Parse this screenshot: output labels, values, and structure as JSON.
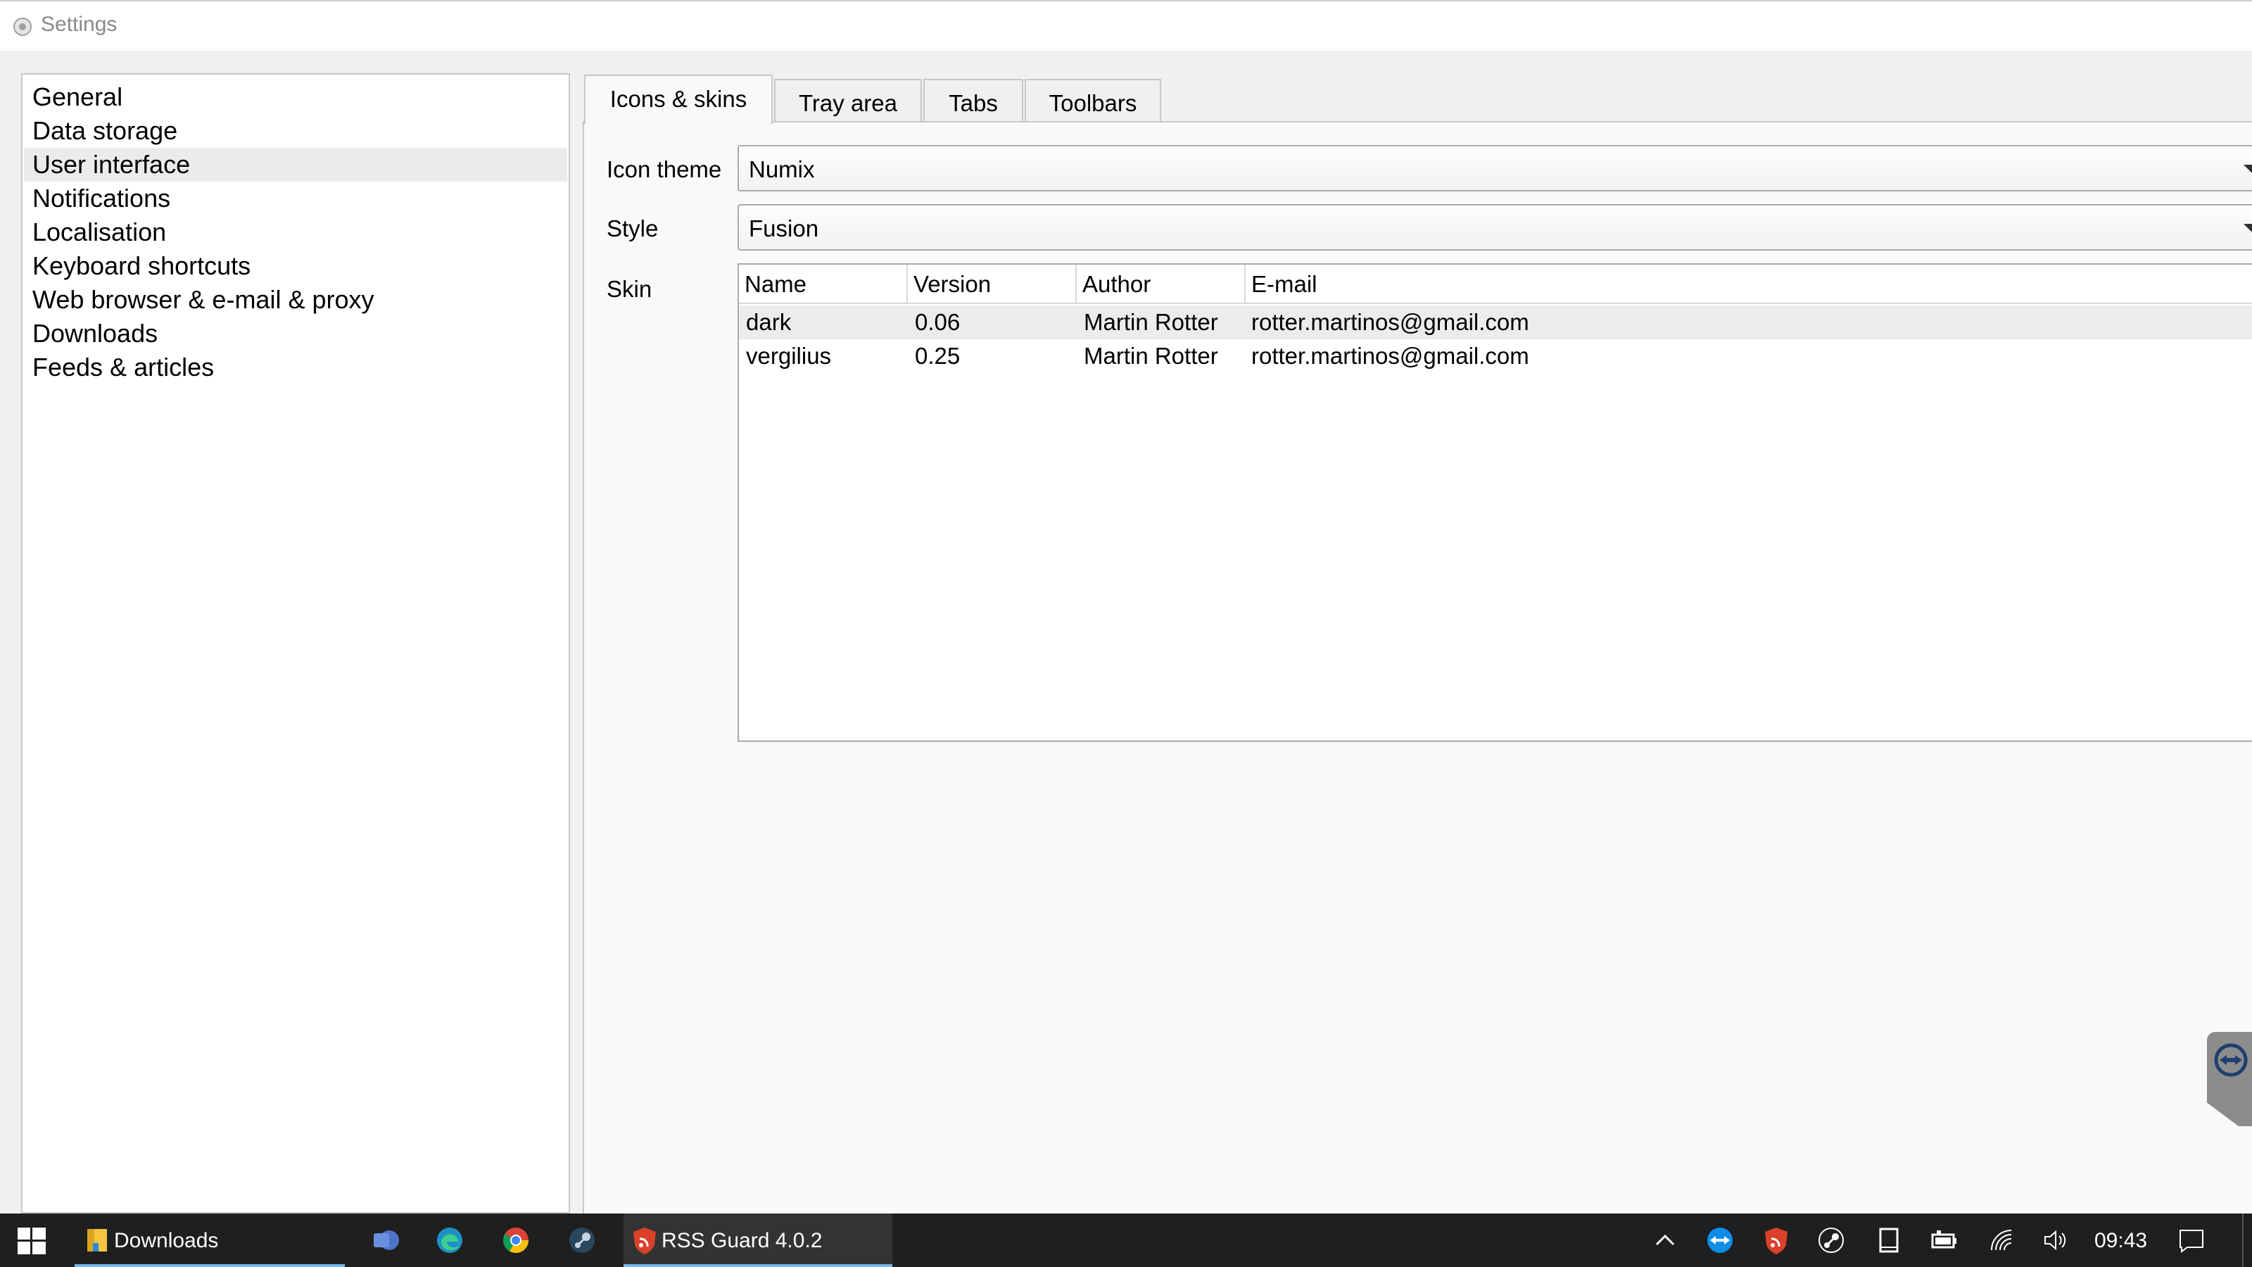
{
  "window": {
    "title": "Settings",
    "icon": "settings-gear-icon"
  },
  "nav": {
    "items": [
      {
        "label": "General"
      },
      {
        "label": "Data storage"
      },
      {
        "label": "User interface",
        "selected": true
      },
      {
        "label": "Notifications"
      },
      {
        "label": "Localisation"
      },
      {
        "label": "Keyboard shortcuts"
      },
      {
        "label": "Web browser & e-mail & proxy"
      },
      {
        "label": "Downloads"
      },
      {
        "label": "Feeds & articles"
      }
    ]
  },
  "tabs": [
    {
      "label": "Icons & skins",
      "active": true
    },
    {
      "label": "Tray area"
    },
    {
      "label": "Tabs"
    },
    {
      "label": "Toolbars"
    }
  ],
  "form": {
    "icon_theme": {
      "label": "Icon theme",
      "value": "Numix"
    },
    "style": {
      "label": "Style",
      "value": "Fusion"
    },
    "skin": {
      "label": "Skin"
    }
  },
  "skins_table": {
    "columns": [
      "Name",
      "Version",
      "Author",
      "E-mail"
    ],
    "rows": [
      {
        "name": "dark",
        "version": "0.06",
        "author": "Martin Rotter",
        "email": "rotter.martinos@gmail.com",
        "selected": true
      },
      {
        "name": "vergilius",
        "version": "0.25",
        "author": "Martin Rotter",
        "email": "rotter.martinos@gmail.com"
      }
    ]
  },
  "taskbar": {
    "start": "windows-start-icon",
    "apps": [
      {
        "label": "Downloads",
        "icon": "file-explorer-icon"
      },
      {
        "label": "RSS Guard 4.0.2",
        "icon": "rss-guard-icon"
      }
    ],
    "pinned_icons": [
      "teams-icon",
      "edge-icon",
      "chrome-icon",
      "steam-icon"
    ],
    "tray_icons": [
      "show-hidden-icons-chevron-icon",
      "teamviewer-icon",
      "rss-guard-tray-icon",
      "steam-tray-icon",
      "tablet-icon",
      "battery-icon",
      "wifi-icon",
      "volume-icon"
    ],
    "clock": "09:43",
    "notification_icon": "action-center-icon"
  },
  "colors": {
    "accent": "#76b9ed",
    "taskbar_bg": "#1f1f1f",
    "selection": "#ececec"
  }
}
